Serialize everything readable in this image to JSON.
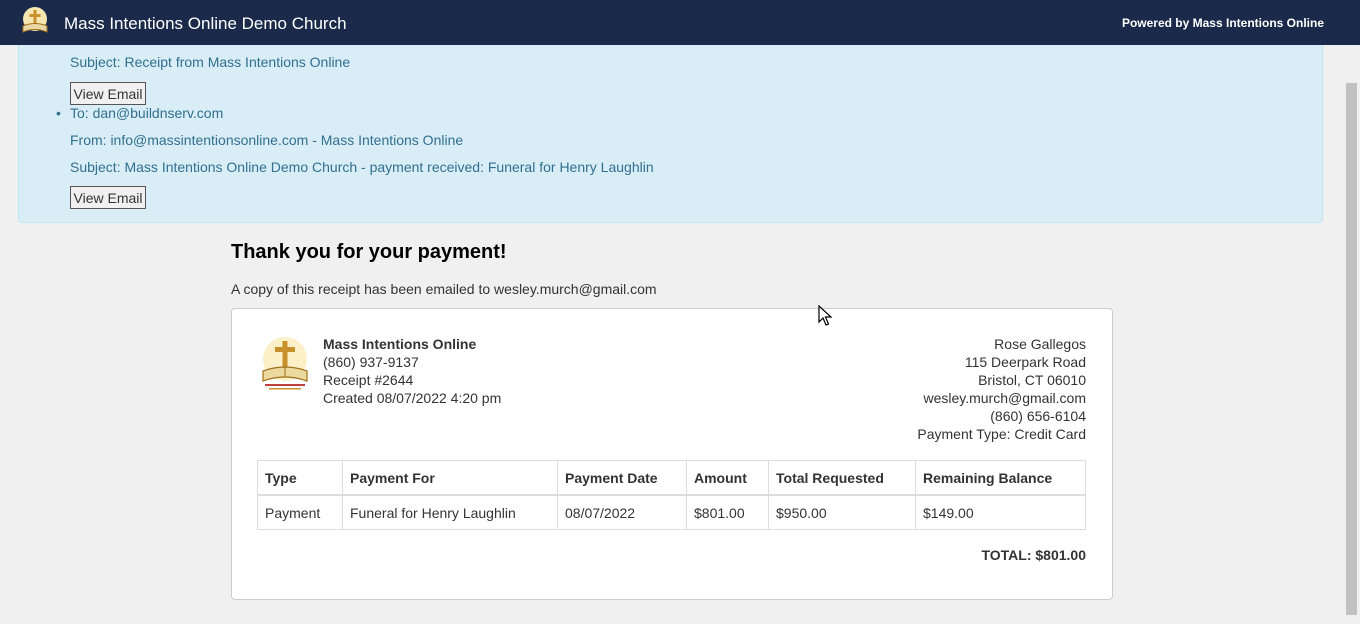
{
  "header": {
    "title": "Mass Intentions Online Demo Church",
    "powered_by": "Powered by Mass Intentions Online"
  },
  "emails": {
    "first_subject": "Subject: Receipt from Mass Intentions Online",
    "view_email_label": "View Email",
    "second": {
      "to": "To: dan@buildnserv.com",
      "from": "From: info@massintentionsonline.com - Mass Intentions Online",
      "subject": "Subject: Mass Intentions Online Demo Church - payment received: Funeral for Henry Laughlin"
    }
  },
  "receipt": {
    "thanks": "Thank you for your payment!",
    "copy_note": "A copy of this receipt has been emailed to wesley.murch@gmail.com",
    "from": {
      "org": "Mass Intentions Online",
      "phone": "(860) 937-9137",
      "receipt_no": "Receipt #2644",
      "created": "Created 08/07/2022 4:20 pm"
    },
    "to": {
      "name": "Rose Gallegos",
      "street": "115 Deerpark Road",
      "city": "Bristol, CT 06010",
      "email": "wesley.murch@gmail.com",
      "phone": "(860) 656-6104",
      "payment_type": "Payment Type: Credit Card"
    },
    "table": {
      "headers": [
        "Type",
        "Payment For",
        "Payment Date",
        "Amount",
        "Total Requested",
        "Remaining Balance"
      ],
      "rows": [
        [
          "Payment",
          "Funeral for Henry Laughlin",
          "08/07/2022",
          "$801.00",
          "$950.00",
          "$149.00"
        ]
      ]
    },
    "total": "TOTAL: $801.00"
  },
  "colors": {
    "header_bg": "#1b2a4a",
    "info_panel_bg": "#d9edf7",
    "info_text": "#31708f"
  }
}
